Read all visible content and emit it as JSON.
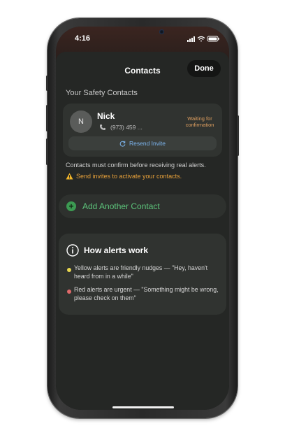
{
  "status_bar": {
    "time": "4:16"
  },
  "nav": {
    "title": "Contacts",
    "done_label": "Done"
  },
  "section_label": "Your Safety Contacts",
  "contact": {
    "initial": "N",
    "name": "Nick",
    "phone": "(973) 459 ...",
    "status": "Waiting for confirmation",
    "resend_label": "Resend Invite"
  },
  "note": "Contacts must confirm before receiving real alerts.",
  "warning": "Send invites to activate your contacts.",
  "add_contact_label": "Add Another Contact",
  "how_alerts": {
    "title": "How alerts work",
    "items": [
      {
        "color": "#e7d64f",
        "text": "Yellow alerts are friendly nudges — \"Hey, haven't heard from in a while\""
      },
      {
        "color": "#e06a6a",
        "text": "Red alerts are urgent — \"Something might be wrong, please check on them\""
      }
    ]
  },
  "colors": {
    "accent_green": "#5cc27a",
    "warning_orange": "#e8a13a",
    "link_blue": "#7db6f0"
  },
  "icons": [
    "phone-icon",
    "refresh-icon",
    "warning-icon",
    "plus-circle-icon",
    "info-icon",
    "signal-icon",
    "wifi-icon",
    "battery-icon"
  ]
}
